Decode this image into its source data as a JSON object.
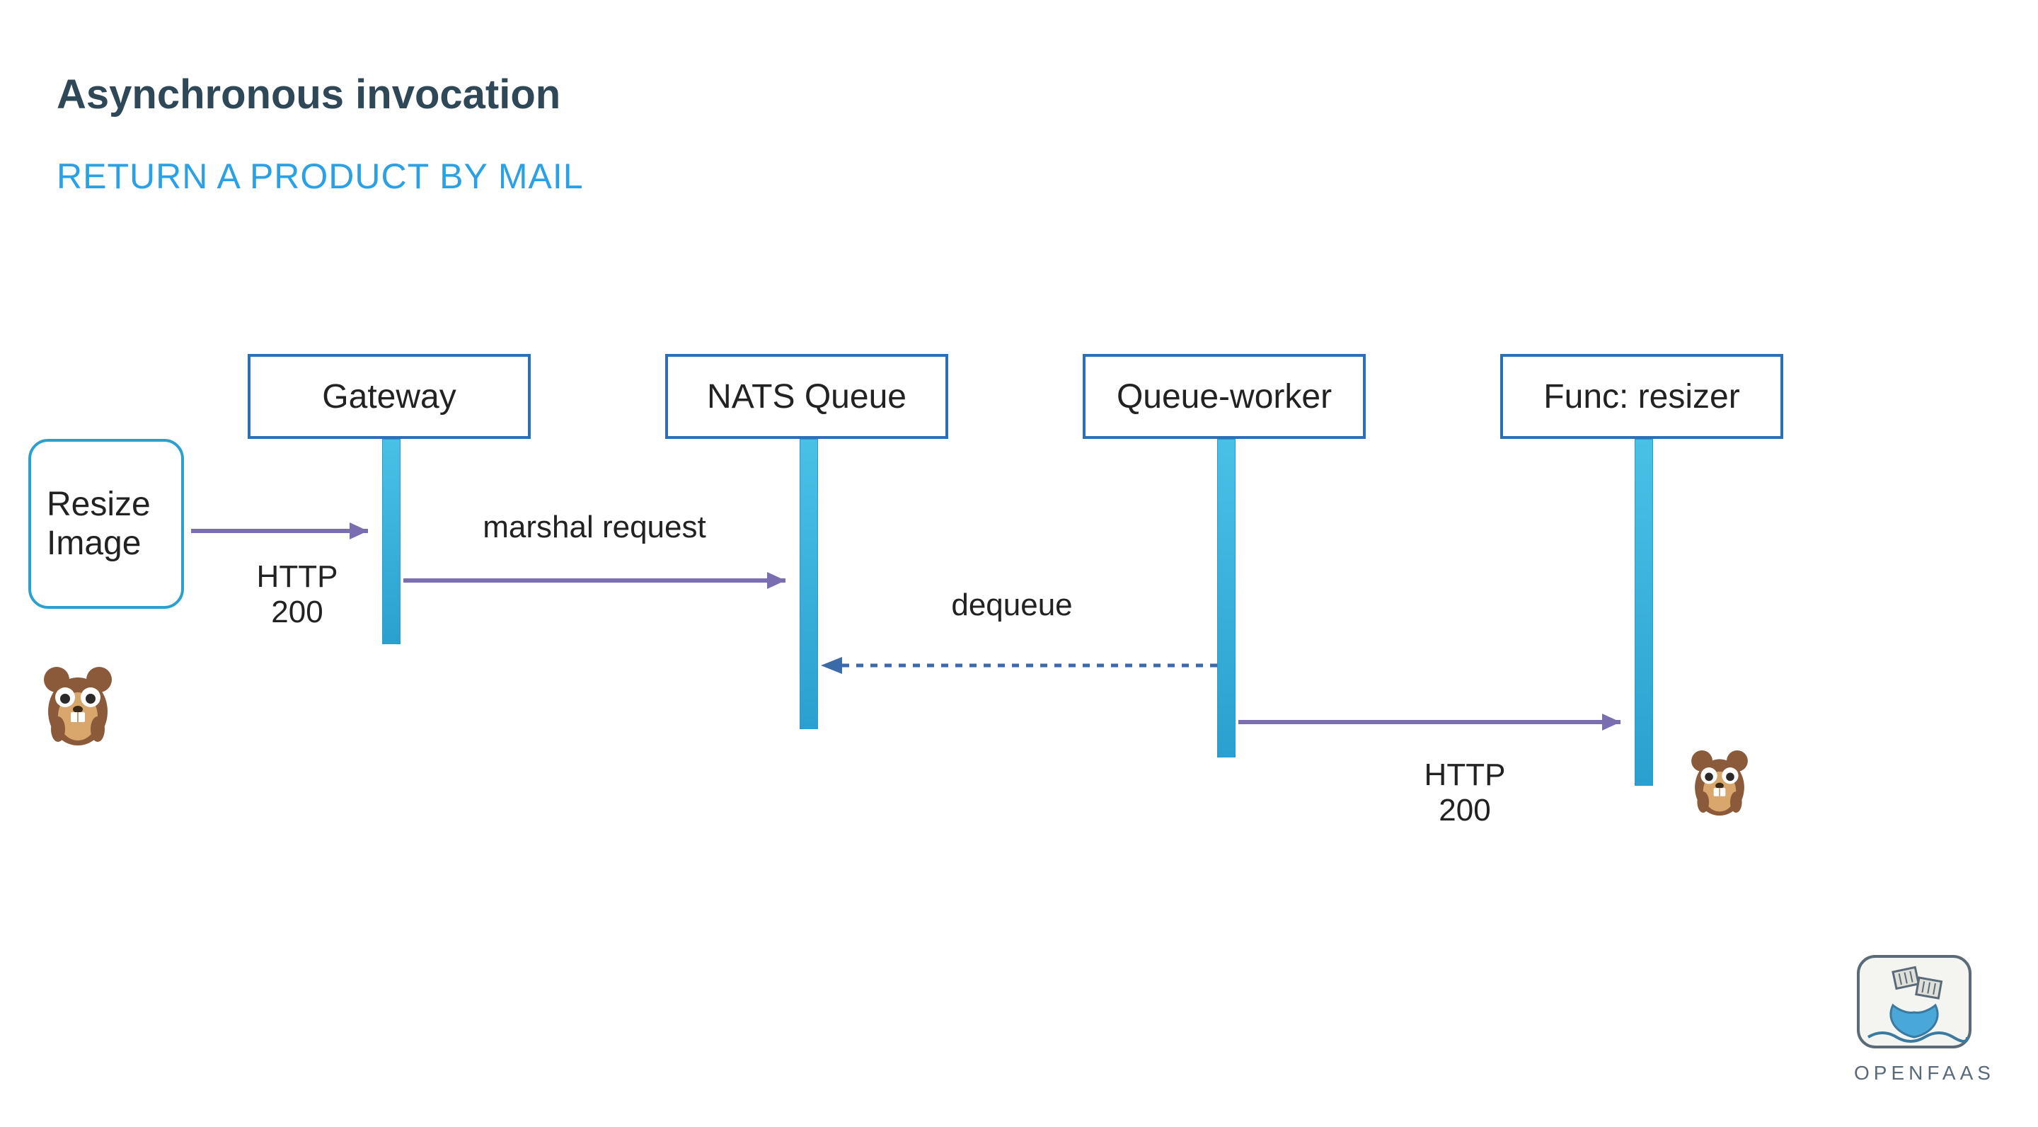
{
  "title": "Asynchronous invocation",
  "subtitle": "RETURN A PRODUCT BY MAIL",
  "actor": {
    "line1": "Resize",
    "line2": "Image"
  },
  "nodes": {
    "gateway": "Gateway",
    "nats": "NATS Queue",
    "queue_worker": "Queue-worker",
    "func": "Func: resizer"
  },
  "messages": {
    "to_gateway_response": "HTTP 200",
    "marshal": "marshal request",
    "dequeue": "dequeue",
    "to_func_response": "HTTP 200"
  },
  "logo": {
    "text_light": "OPEN",
    "text_bold": "FAAS"
  }
}
